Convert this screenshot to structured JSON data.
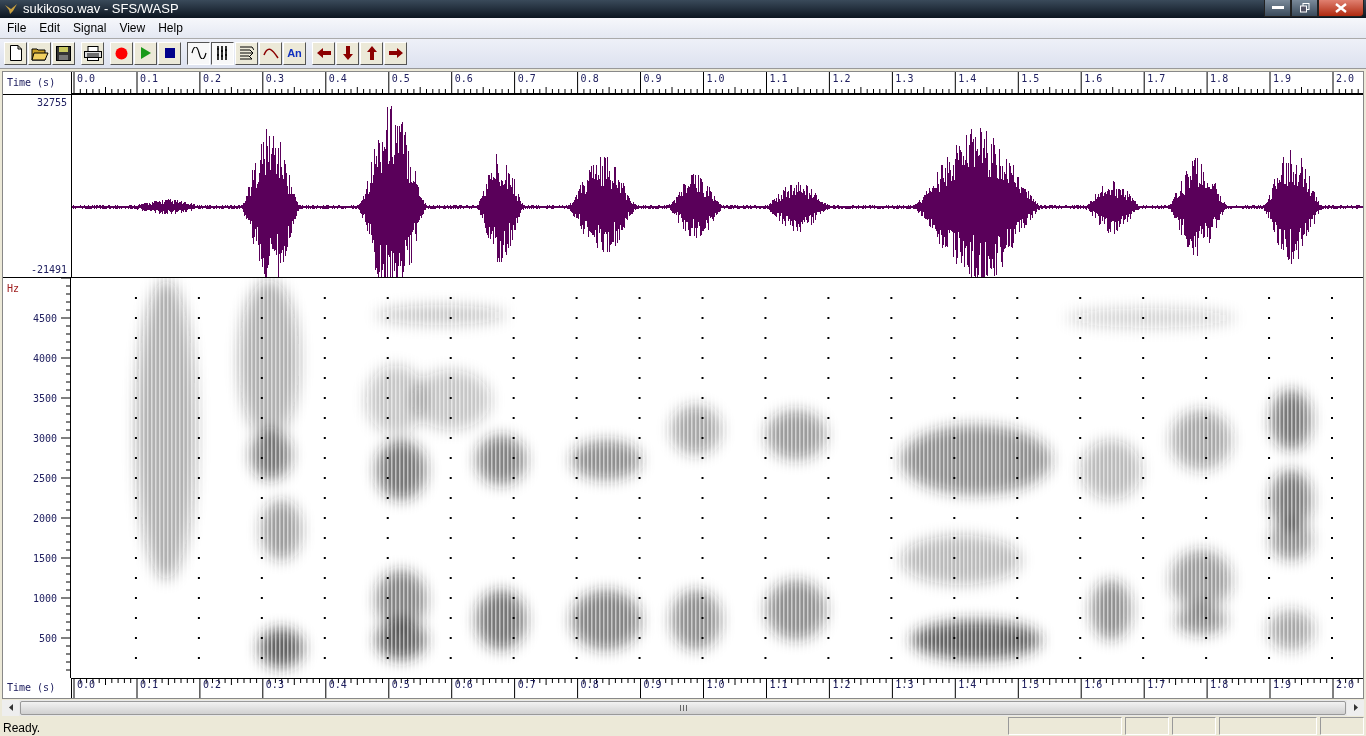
{
  "window": {
    "title": "sukikoso.wav - SFS/WASP"
  },
  "menu": [
    {
      "label": "File"
    },
    {
      "label": "Edit"
    },
    {
      "label": "Signal"
    },
    {
      "label": "View"
    },
    {
      "label": "Help"
    }
  ],
  "toolbar": [
    {
      "buttons": [
        {
          "kind": "new",
          "pressed": false
        },
        {
          "kind": "open",
          "pressed": false
        },
        {
          "kind": "save",
          "pressed": false
        }
      ]
    },
    {
      "buttons": [
        {
          "kind": "print",
          "pressed": false
        }
      ]
    },
    {
      "buttons": [
        {
          "kind": "record",
          "pressed": false
        },
        {
          "kind": "play",
          "pressed": false
        },
        {
          "kind": "stop",
          "pressed": false
        }
      ]
    },
    {
      "buttons": [
        {
          "kind": "waveform",
          "pressed": true
        },
        {
          "kind": "spectrogram",
          "pressed": true
        },
        {
          "kind": "spectrum",
          "pressed": false
        },
        {
          "kind": "pitch",
          "pressed": false
        },
        {
          "kind": "annotation",
          "pressed": false,
          "label": "An"
        }
      ]
    },
    {
      "buttons": [
        {
          "kind": "left",
          "pressed": false
        },
        {
          "kind": "down",
          "pressed": false
        },
        {
          "kind": "up",
          "pressed": false
        },
        {
          "kind": "right",
          "pressed": false
        }
      ]
    }
  ],
  "time_axis_top": {
    "label": "Time (s)",
    "ticks": [
      "0.0",
      "0.1",
      "0.2",
      "0.3",
      "0.4",
      "0.5",
      "0.6",
      "0.7",
      "0.8",
      "0.9",
      "1.0",
      "1.1",
      "1.2",
      "1.3",
      "1.4",
      "1.5",
      "1.6",
      "1.7",
      "1.8",
      "1.9",
      "2.0"
    ]
  },
  "waveform": {
    "max": "32755",
    "min": "-21491"
  },
  "spectrogram": {
    "unit": "Hz",
    "ticks": [
      "4500",
      "4000",
      "3500",
      "3000",
      "2500",
      "2000",
      "1500",
      "1000",
      "500"
    ]
  },
  "time_axis_bottom": {
    "label": "Time (s)",
    "ticks": [
      "0.0",
      "0.1",
      "0.2",
      "0.3",
      "0.4",
      "0.5",
      "0.6",
      "0.7",
      "0.8",
      "0.9",
      "1.0",
      "1.1",
      "1.2",
      "1.3",
      "1.4",
      "1.5",
      "1.6",
      "1.7",
      "1.8",
      "1.9",
      "2.0"
    ]
  },
  "status_bar": {
    "text": "Ready."
  }
}
